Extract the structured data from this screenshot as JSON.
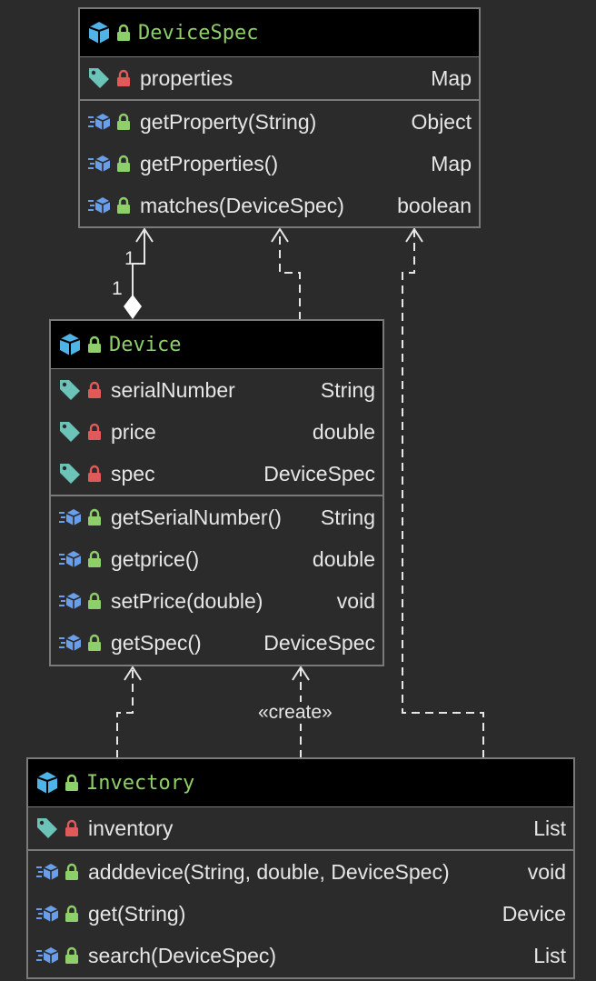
{
  "classes": {
    "devicespec": {
      "title": "DeviceSpec",
      "fields": [
        {
          "name": "properties",
          "type": "Map"
        }
      ],
      "methods": [
        {
          "name": "getProperty(String)",
          "type": "Object"
        },
        {
          "name": "getProperties()",
          "type": "Map"
        },
        {
          "name": "matches(DeviceSpec)",
          "type": "boolean"
        }
      ]
    },
    "device": {
      "title": "Device",
      "fields": [
        {
          "name": "serialNumber",
          "type": "String"
        },
        {
          "name": "price",
          "type": "double"
        },
        {
          "name": "spec",
          "type": "DeviceSpec"
        }
      ],
      "methods": [
        {
          "name": "getSerialNumber()",
          "type": "String"
        },
        {
          "name": "getprice()",
          "type": "double"
        },
        {
          "name": "setPrice(double)",
          "type": "void"
        },
        {
          "name": "getSpec()",
          "type": "DeviceSpec"
        }
      ]
    },
    "invectory": {
      "title": "Invectory",
      "fields": [
        {
          "name": "inventory",
          "type": "List"
        }
      ],
      "methods": [
        {
          "name": "adddevice(String, double, DeviceSpec)",
          "type": "void"
        },
        {
          "name": "get(String)",
          "type": "Device"
        },
        {
          "name": "search(DeviceSpec)",
          "type": "List"
        }
      ]
    }
  },
  "relations": {
    "composition_source_multiplicity": "1",
    "composition_target_multiplicity": "1",
    "create_label": "«create»"
  },
  "colors": {
    "background": "#2b2b2b",
    "header": "#000000",
    "border": "#7a7a7a",
    "class_title": "#8fcf6a",
    "field_lock": "#e05a5a",
    "method_lock": "#8fcf6a",
    "class_icon": "#4fb3e8",
    "field_tag": "#6cc4b9"
  }
}
